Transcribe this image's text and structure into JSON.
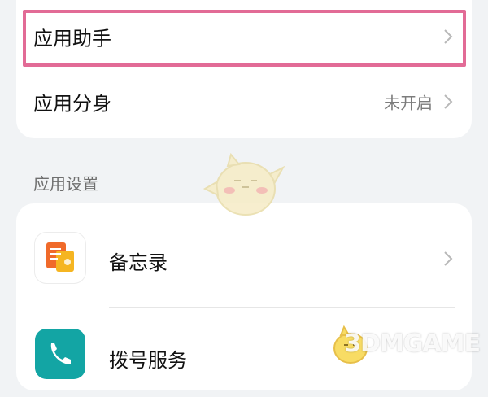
{
  "top_card": {
    "rows": [
      {
        "label": "应用助手",
        "value": ""
      },
      {
        "label": "应用分身",
        "value": "未开启"
      }
    ]
  },
  "section": {
    "title": "应用设置"
  },
  "app_card": {
    "items": [
      {
        "label": "备忘录",
        "icon": "memo-app-icon"
      },
      {
        "label": "拨号服务",
        "icon": "phone-app-icon"
      }
    ]
  },
  "watermark": {
    "text": "3DMGAME"
  },
  "colors": {
    "highlight": "#e26b96",
    "background": "#f1f3f5",
    "card": "#ffffff"
  }
}
